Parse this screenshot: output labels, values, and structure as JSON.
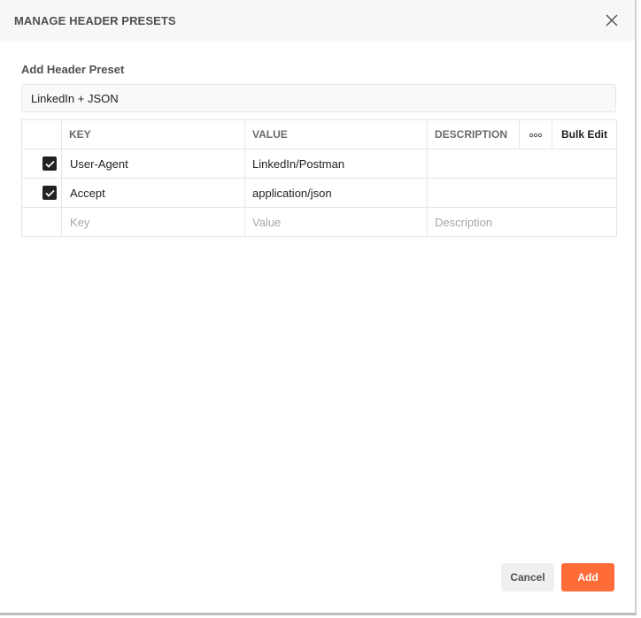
{
  "modal": {
    "title": "MANAGE HEADER PRESETS",
    "close_icon": "close-icon"
  },
  "form": {
    "section_label": "Add Header Preset",
    "preset_name_value": "LinkedIn + JSON"
  },
  "table": {
    "headers": {
      "key": "KEY",
      "value": "VALUE",
      "description": "DESCRIPTION",
      "more_icon": "more-horizontal-icon",
      "bulk_edit": "Bulk Edit"
    },
    "rows": [
      {
        "checked": true,
        "key": "User-Agent",
        "value": "LinkedIn/Postman",
        "description": ""
      },
      {
        "checked": true,
        "key": "Accept",
        "value": "application/json",
        "description": ""
      }
    ],
    "empty_row": {
      "key_placeholder": "Key",
      "value_placeholder": "Value",
      "description_placeholder": "Description"
    }
  },
  "footer": {
    "cancel_label": "Cancel",
    "add_label": "Add"
  },
  "colors": {
    "accent": "#ff6c37",
    "header_bg": "#f7f7f7",
    "checkbox": "#212121"
  }
}
